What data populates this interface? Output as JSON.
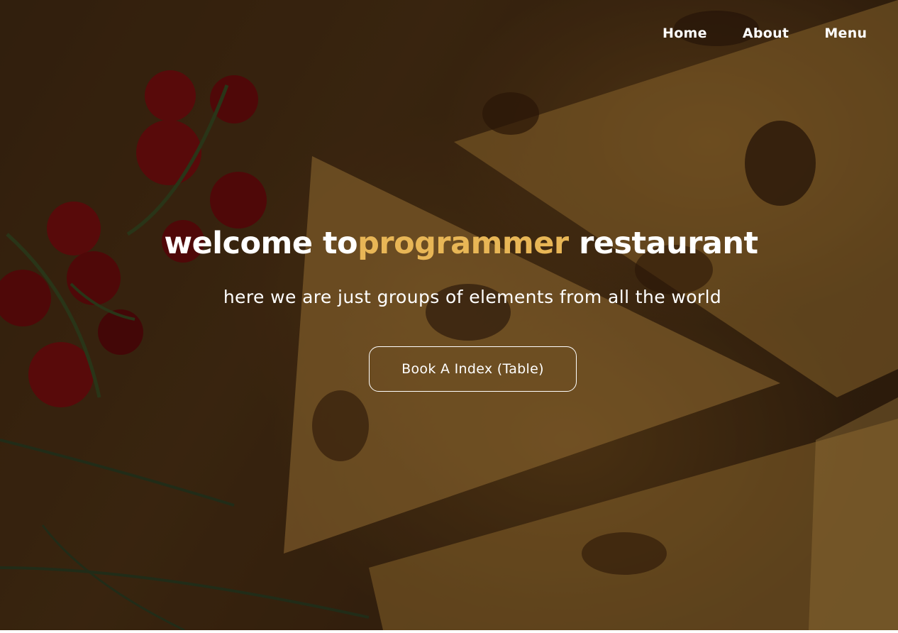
{
  "nav": {
    "items": [
      {
        "label": "Home"
      },
      {
        "label": "About"
      },
      {
        "label": "Menu"
      }
    ]
  },
  "hero": {
    "headline_prefix": "welcome to",
    "headline_accent": "programmer",
    "headline_suffix": " restaurant",
    "subtitle": "here we are just groups of elements from all the world",
    "cta_label": "Book A Index (Table)",
    "accent_color": "#e8b656"
  }
}
